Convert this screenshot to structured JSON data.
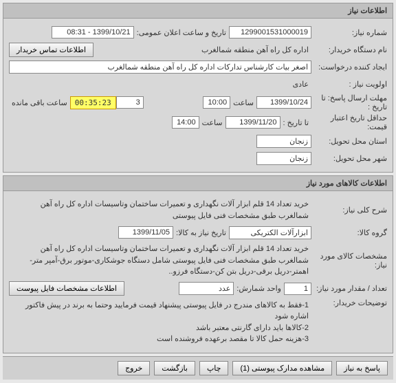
{
  "panel1": {
    "title": "اطلاعات نیاز",
    "req_no_label": "شماره نیاز:",
    "req_no": "1299001531000019",
    "ann_label": "تاریخ و ساعت اعلان عمومی:",
    "ann_val": "1399/10/21 - 08:31",
    "buyer_dev_label": "نام دستگاه خریدار:",
    "buyer_dev": "اداره کل راه آهن منطقه شمالغرب",
    "contact_btn": "اطلاعات تماس خریدار",
    "req_creator_label": "ایجاد کننده درخواست:",
    "req_creator": "اصغر بیات کارشناس تدارکات اداره کل راه آهن منطقه شمالغرب",
    "priority_label": "اولویت نیاز :",
    "priority": "عادی",
    "deadline_label": "مهلت ارسال پاسخ:  تا تاریخ :",
    "deadline_date": "1399/10/24",
    "time_label": "ساعت",
    "deadline_time": "10:00",
    "days_remain": "3",
    "timer": "00:35:23",
    "remain_suffix": "ساعت باقی مانده",
    "min_validity_label": "حداقل تاریخ اعتبار قیمت:",
    "min_validity_to": "تا تاریخ :",
    "min_validity_date": "1399/11/20",
    "min_validity_time": "14:00",
    "province_label": "استان محل تحویل:",
    "province": "زنجان",
    "city_label": "شهر محل تحویل:",
    "city": "زنجان"
  },
  "panel2": {
    "title": "اطلاعات کالاهای مورد نیاز",
    "summary_label": "شرح کلی نیاز:",
    "summary": "خرید تعداد 14 قلم ابزار آلات نگهداری و تعمیرات ساختمان وتاسیسات اداره کل راه آهن شمالغرب طبق مشخصات فنی فایل پیوستی",
    "group_label": "گروه کالا:",
    "group": "ابزارآلات الکتریکی",
    "need_by_label": "تاریخ نیاز به کالا:",
    "need_by": "1399/11/05",
    "spec_label": "مشخصات کالای مورد نیاز:",
    "spec": "خرید تعداد 14 قلم ابزار آلات نگهداری و تعمیرات ساختمان وتاسیسات اداره کل راه آهن شمالغرب طبق مشخصات فنی فایل پیوستی شامل دستگاه جوشکاری-موتور برق-آمپر متر-اهمتر-دریل برقی-دریل بتن کن-دستگاه فرزو..",
    "qty_label": "تعداد / مقدار مورد نیاز:",
    "qty": "1",
    "unit_label": "واحد شمارش:",
    "unit": "عدد",
    "attach_btn": "اطلاعات مشخصات فایل پیوست",
    "notes_label": "توضیحات خریدار:",
    "notes": "1-فقط به کالاهای مندرج در فایل پیوستی پیشنهاد قیمت فرمایید وحتما به برند در پیش فاکتور اشاره شود\n2-کالاها باید دارای گارنتی معتبر باشد\n3-هزینه حمل کالا تا مقصد برعهده فروشنده است"
  },
  "actions": {
    "reply": "پاسخ به نیاز",
    "view_attach": "مشاهده مدارک پیوستی (1)",
    "print": "چاپ",
    "back": "بازگشت",
    "exit": "خروج"
  }
}
